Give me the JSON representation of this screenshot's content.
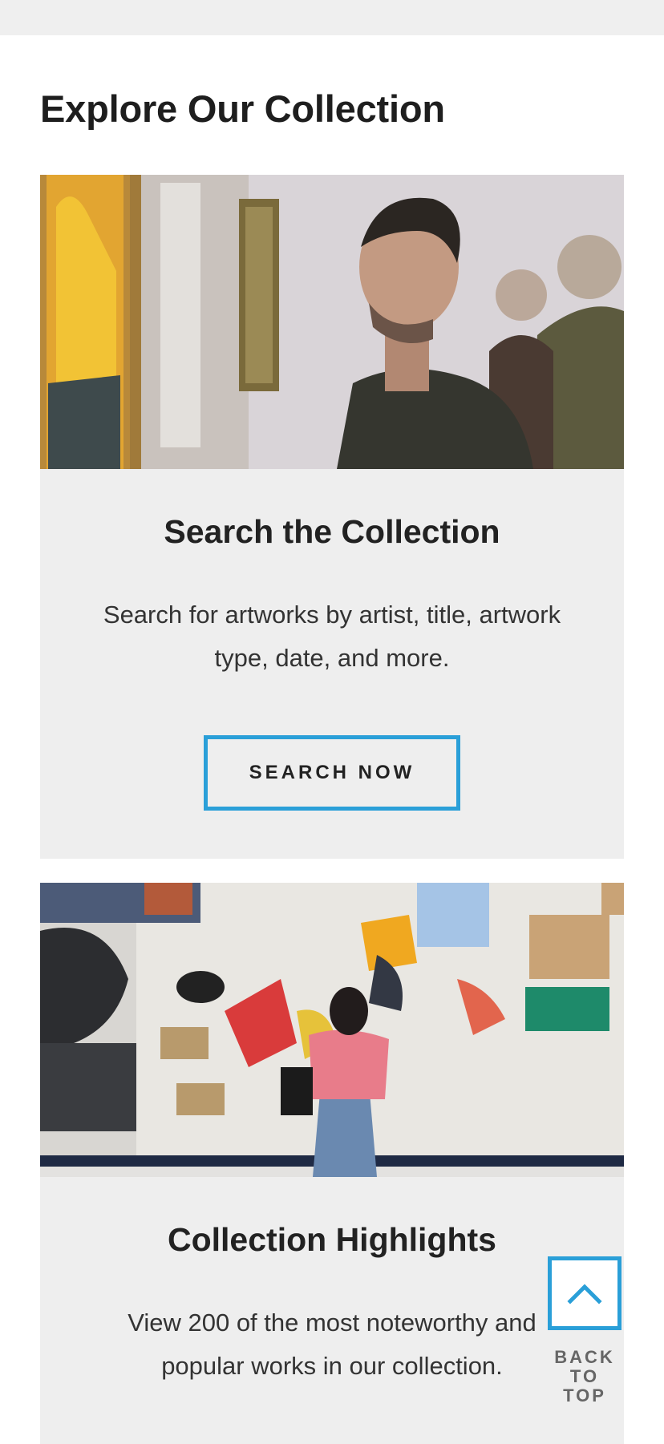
{
  "section": {
    "heading": "Explore Our Collection"
  },
  "cards": [
    {
      "title": "Search the Collection",
      "description": "Search for artworks by artist, title, artwork type, date, and more.",
      "button_label": "SEARCH NOW",
      "image_icon": "museum-visitor-photo"
    },
    {
      "title": "Collection Highlights",
      "description": "View 200 of the most noteworthy and popular works in our collection.",
      "image_icon": "gallery-wall-photo"
    }
  ],
  "back_to_top": {
    "label": "BACK\nTO TOP",
    "icon": "chevron-up-icon"
  },
  "colors": {
    "accent": "#2a9fd8",
    "card_bg": "#eeeeee",
    "heading": "#1e1e1e"
  }
}
